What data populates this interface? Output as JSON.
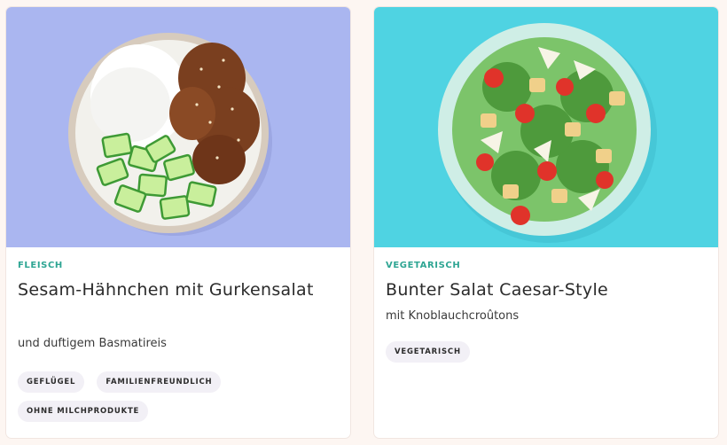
{
  "cards": [
    {
      "category": "FLEISCH",
      "title": "Sesam-Hähnchen mit Gurkensalat",
      "subtitle": "und duftigem Basmatireis",
      "tags": [
        "GEFLÜGEL",
        "FAMILIENFREUNDLICH",
        "OHNE MILCHPRODUKTE"
      ],
      "image_bg": "#aab6f0"
    },
    {
      "category": "VEGETARISCH",
      "title": "Bunter Salat Caesar-Style",
      "subtitle": "mit Knoblauchcroûtons",
      "tags": [
        "VEGETARISCH"
      ],
      "image_bg": "#4fd3e2"
    }
  ],
  "colors": {
    "category": "#2ea593",
    "tag_bg": "#f2f0f6",
    "page_bg": "#fdf6f2"
  }
}
